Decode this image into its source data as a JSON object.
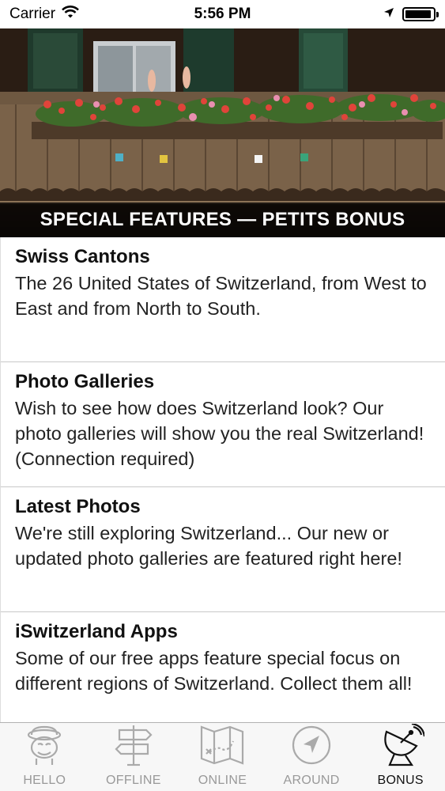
{
  "status_bar": {
    "carrier": "Carrier",
    "time": "5:56 PM",
    "battery_level": 0.95
  },
  "hero": {
    "caption": "SPECIAL FEATURES — PETITS BONUS"
  },
  "list": {
    "items": [
      {
        "title": "Swiss Cantons",
        "desc": "The 26 United States of Switzerland, from West to East and from North to South."
      },
      {
        "title": "Photo Galleries",
        "desc": "Wish to see how does Switzerland look? Our photo galleries will show you the real Switzerland! (Connection required)"
      },
      {
        "title": "Latest Photos",
        "desc": "We're still exploring Switzerland... Our new or updated photo galleries are featured right here!"
      },
      {
        "title": "iSwitzerland Apps",
        "desc": "Some of our free apps feature special focus on different regions of Switzerland. Collect them all!"
      }
    ]
  },
  "tab_bar": {
    "tabs": [
      {
        "label": "HELLO",
        "icon": "hello-face-icon"
      },
      {
        "label": "OFFLINE",
        "icon": "signpost-icon"
      },
      {
        "label": "ONLINE",
        "icon": "treasure-map-icon"
      },
      {
        "label": "AROUND",
        "icon": "location-arrow-icon"
      },
      {
        "label": "BONUS",
        "icon": "satellite-dish-icon"
      }
    ],
    "active": "BONUS"
  },
  "colors": {
    "caption_bg": "#000000",
    "tab_inactive": "#999999",
    "tab_active": "#111111"
  }
}
